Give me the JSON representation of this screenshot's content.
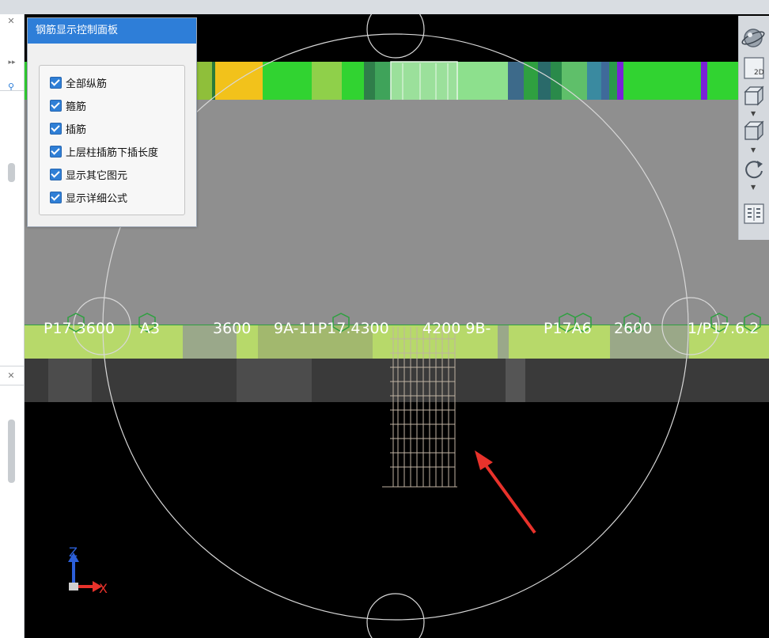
{
  "panel": {
    "title": "钢筋显示控制面板",
    "options": [
      {
        "label": "全部纵筋",
        "checked": true
      },
      {
        "label": "箍筋",
        "checked": true
      },
      {
        "label": "插筋",
        "checked": true
      },
      {
        "label": "上层柱插筋下插长度",
        "checked": true
      },
      {
        "label": "显示其它图元",
        "checked": true
      },
      {
        "label": "显示详细公式",
        "checked": true
      }
    ]
  },
  "toolbar": {
    "view2d_label": "2D",
    "icons": [
      "orbit-sphere-icon",
      "view-2d-icon",
      "view-front-box-icon",
      "view-3d-box-icon",
      "rotate-icon",
      "display-settings-icon"
    ]
  },
  "scene": {
    "labels": [
      "P17.3600",
      "A3",
      "3600",
      "9A-11P17.4300",
      "4200 9B-",
      "P17A6",
      "2600",
      "1/P17.6.2"
    ]
  },
  "axis": {
    "z_label": "Z",
    "x_label": "X"
  },
  "colors": {
    "background": "#000000",
    "slab": "#8f8f8f",
    "beam_light_green": "#b7d96a",
    "accent_blue": "#2e7ed8",
    "arrow_red": "#e8322b"
  }
}
